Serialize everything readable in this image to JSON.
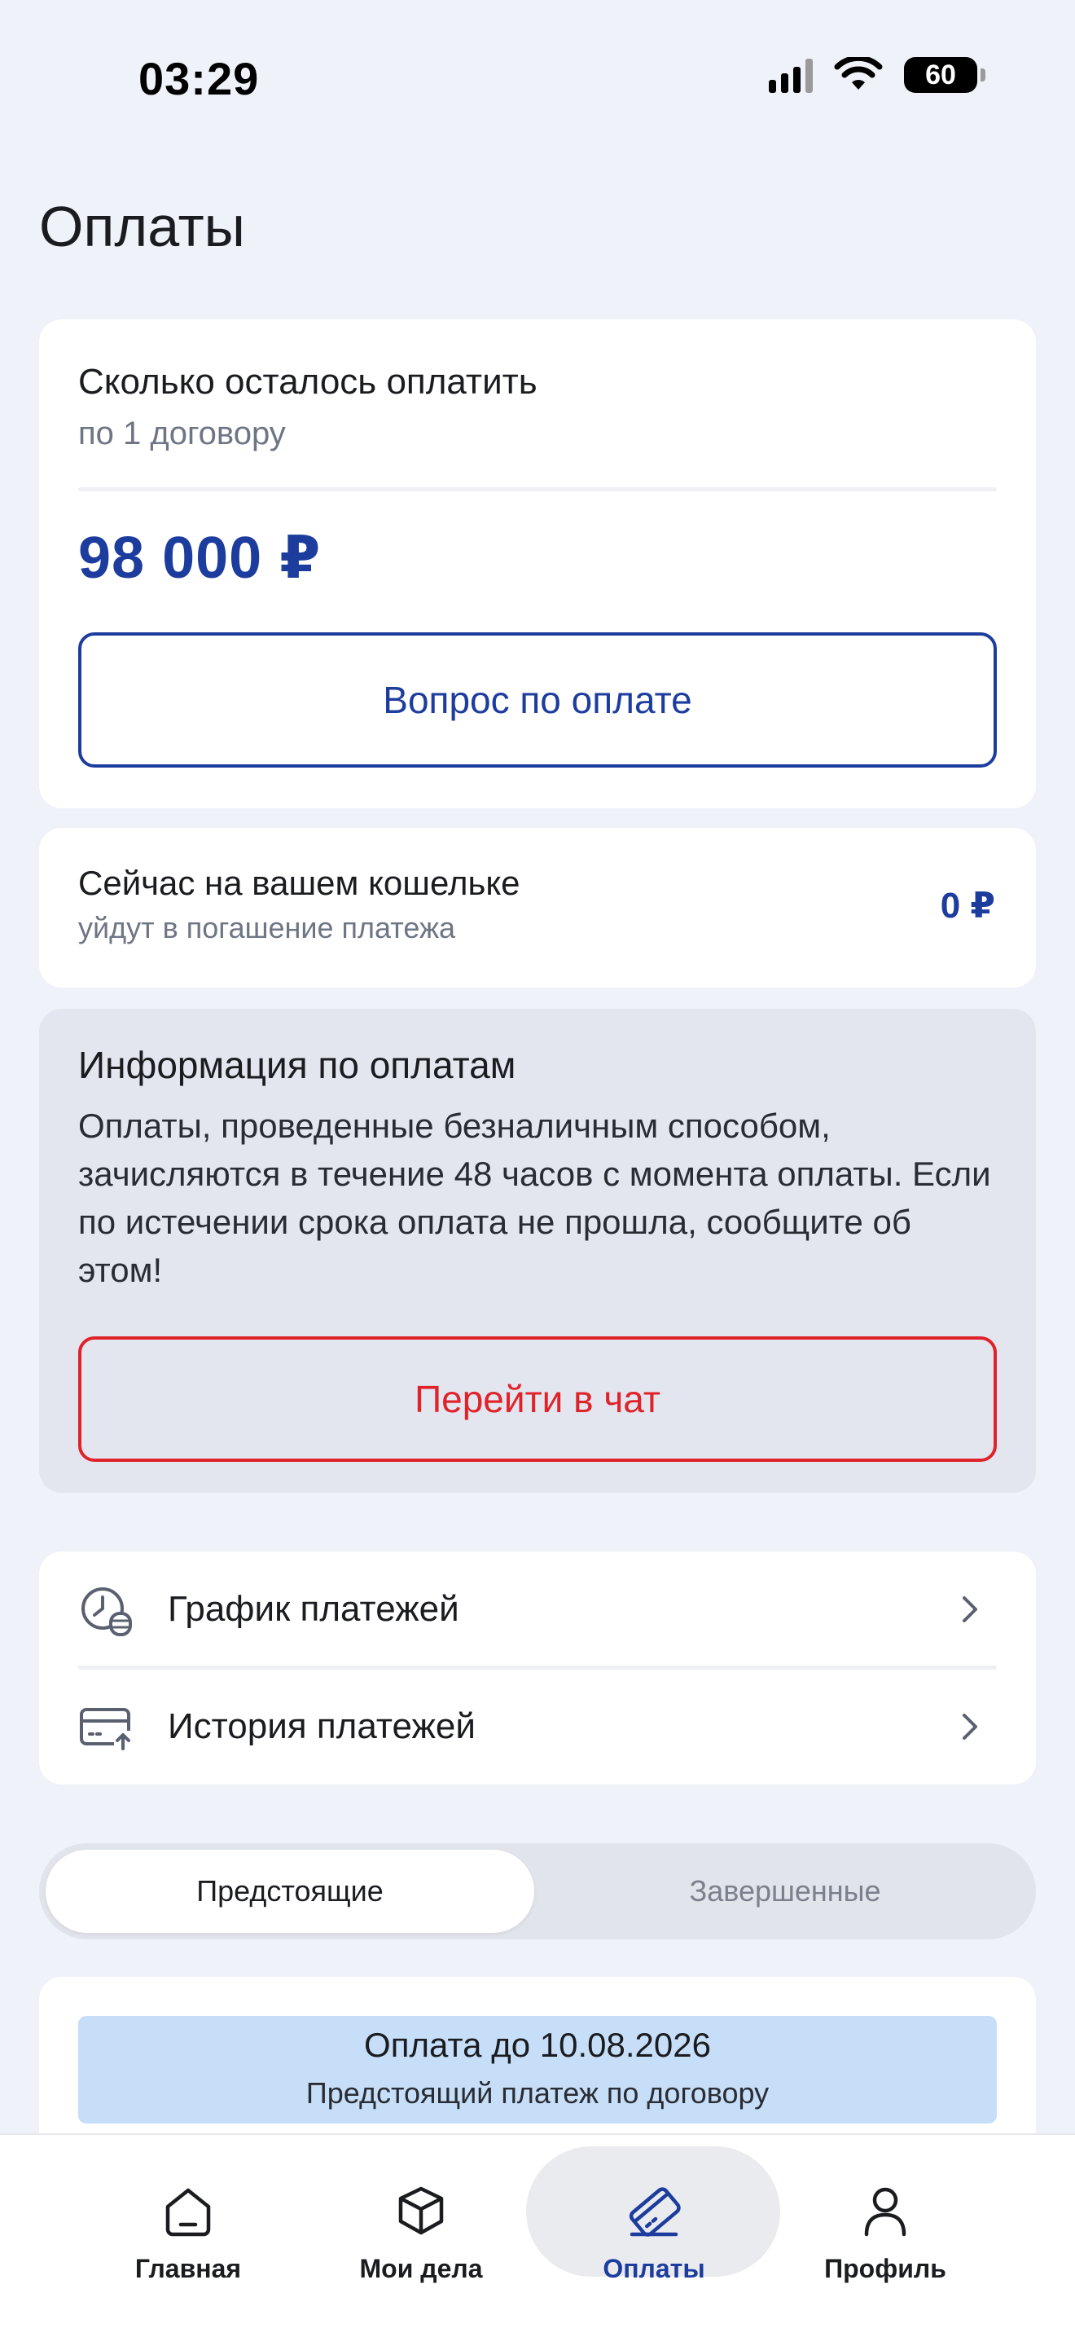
{
  "status_bar": {
    "time": "03:29",
    "battery": "60"
  },
  "page": {
    "title": "Оплаты"
  },
  "remaining": {
    "title": "Сколько осталось оплатить",
    "subtitle": "по 1 договору",
    "amount": "98 000 ₽",
    "button_label": "Вопрос по оплате"
  },
  "wallet": {
    "title": "Сейчас на вашем кошельке",
    "subtitle": "уйдут в погашение платежа",
    "amount": "0 ₽"
  },
  "info": {
    "title": "Информация по оплатам",
    "text": "Оплаты, проведенные безналичным способом, зачисляются в течение 48 часов с момента оплаты. Если по истечении срока оплата не прошла, сообщите об этом!",
    "button_label": "Перейти в чат"
  },
  "links": [
    {
      "label": "График платежей",
      "icon": "clock-coins-icon"
    },
    {
      "label": "История платежей",
      "icon": "card-arrow-icon"
    }
  ],
  "tabs": {
    "active": "Предстоящие",
    "inactive": "Завершенные"
  },
  "payment": {
    "title": "Оплата до 10.08.2026",
    "subtitle": "Предстоящий платеж по договору"
  },
  "nav": [
    {
      "label": "Главная",
      "icon": "home-icon"
    },
    {
      "label": "Мои дела",
      "icon": "box-icon"
    },
    {
      "label": "Оплаты",
      "icon": "payments-card-icon",
      "active": true
    },
    {
      "label": "Профиль",
      "icon": "profile-icon"
    }
  ],
  "colors": {
    "accent_blue": "#1d3d9e",
    "alert_red": "#e0232a",
    "banner_blue": "#c6def8",
    "background": "#eff2f9"
  }
}
